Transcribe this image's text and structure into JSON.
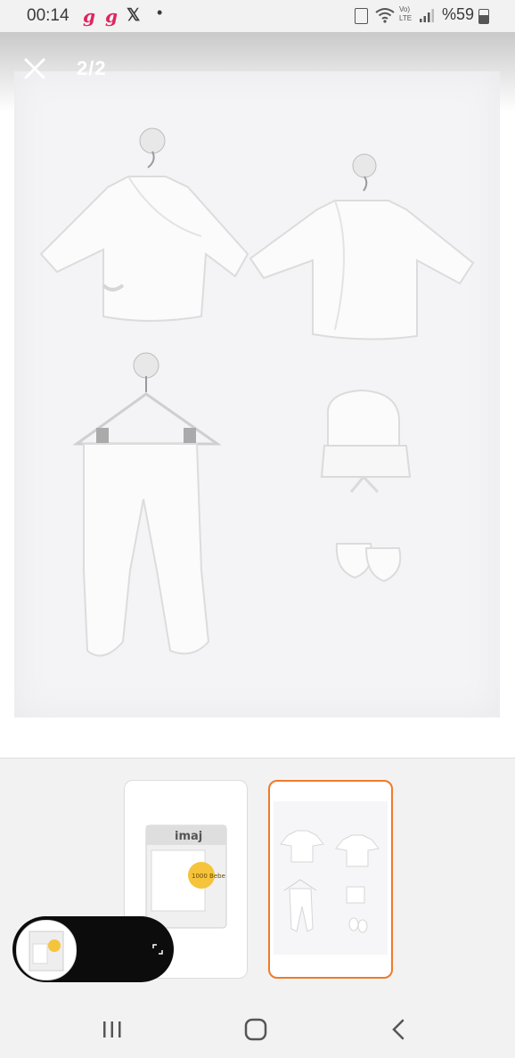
{
  "status_bar": {
    "time": "00:14",
    "app_icon_1": "g",
    "app_icon_2": "g",
    "x_icon": "𝕏",
    "dot": "•",
    "net_label_top": "Vo)",
    "net_label_bottom": "LTE",
    "battery": "%59"
  },
  "viewer": {
    "counter": "2/2"
  },
  "thumbnails": [
    {
      "kind": "box-product-image",
      "brand": "imaj",
      "badge": "1000 Bebe"
    },
    {
      "kind": "clothing-set-image",
      "selected": true
    }
  ],
  "colors": {
    "accent": "#f07a2a",
    "status_bg": "#f2f2f2",
    "pip_bg": "#0c0c0c",
    "box_yellow": "#f5c43a"
  }
}
